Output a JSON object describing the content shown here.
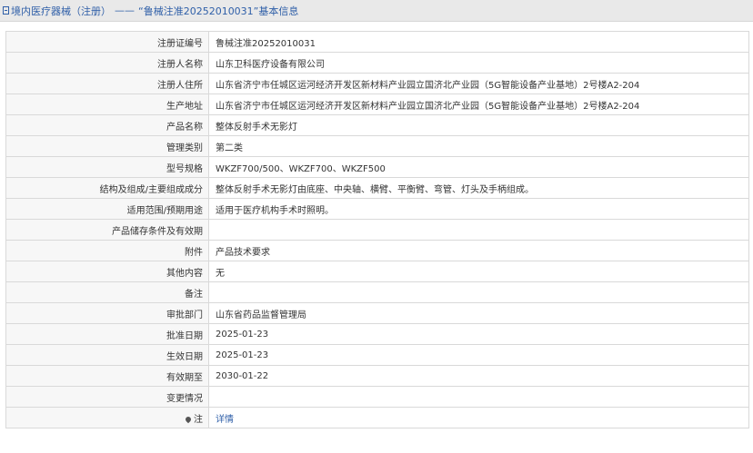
{
  "header": {
    "section": "境内医疗器械（注册）",
    "separator": "——",
    "title": "“鲁械注准20252010031”基本信息"
  },
  "rows": [
    {
      "label": "注册证编号",
      "value": "鲁械注准20252010031"
    },
    {
      "label": "注册人名称",
      "value": "山东卫科医疗设备有限公司"
    },
    {
      "label": "注册人住所",
      "value": "山东省济宁市任城区运河经济开发区新材料产业园立国济北产业园（5G智能设备产业基地）2号楼A2-204"
    },
    {
      "label": "生产地址",
      "value": "山东省济宁市任城区运河经济开发区新材料产业园立国济北产业园（5G智能设备产业基地）2号楼A2-204"
    },
    {
      "label": "产品名称",
      "value": "整体反射手术无影灯"
    },
    {
      "label": "管理类别",
      "value": "第二类"
    },
    {
      "label": "型号规格",
      "value": "WKZF700/500、WKZF700、WKZF500"
    },
    {
      "label": "结构及组成/主要组成成分",
      "value": "整体反射手术无影灯由底座、中央轴、横臂、平衡臂、弯管、灯头及手柄组成。"
    },
    {
      "label": "适用范围/预期用途",
      "value": "适用于医疗机构手术时照明。"
    },
    {
      "label": "产品储存条件及有效期",
      "value": ""
    },
    {
      "label": "附件",
      "value": "产品技术要求"
    },
    {
      "label": "其他内容",
      "value": "无"
    },
    {
      "label": "备注",
      "value": ""
    },
    {
      "label": "审批部门",
      "value": "山东省药品监督管理局"
    },
    {
      "label": "批准日期",
      "value": "2025-01-23"
    },
    {
      "label": "生效日期",
      "value": "2025-01-23"
    },
    {
      "label": "有效期至",
      "value": "2030-01-22"
    },
    {
      "label": "变更情况",
      "value": ""
    }
  ],
  "note_row": {
    "label": "注",
    "link": "详情",
    "icon": "info-pin-icon"
  },
  "colors": {
    "link": "#2f5fa8",
    "header_bg": "#e9e9e9",
    "label_bg": "#f7f7f7",
    "border": "#d9d9d9"
  }
}
